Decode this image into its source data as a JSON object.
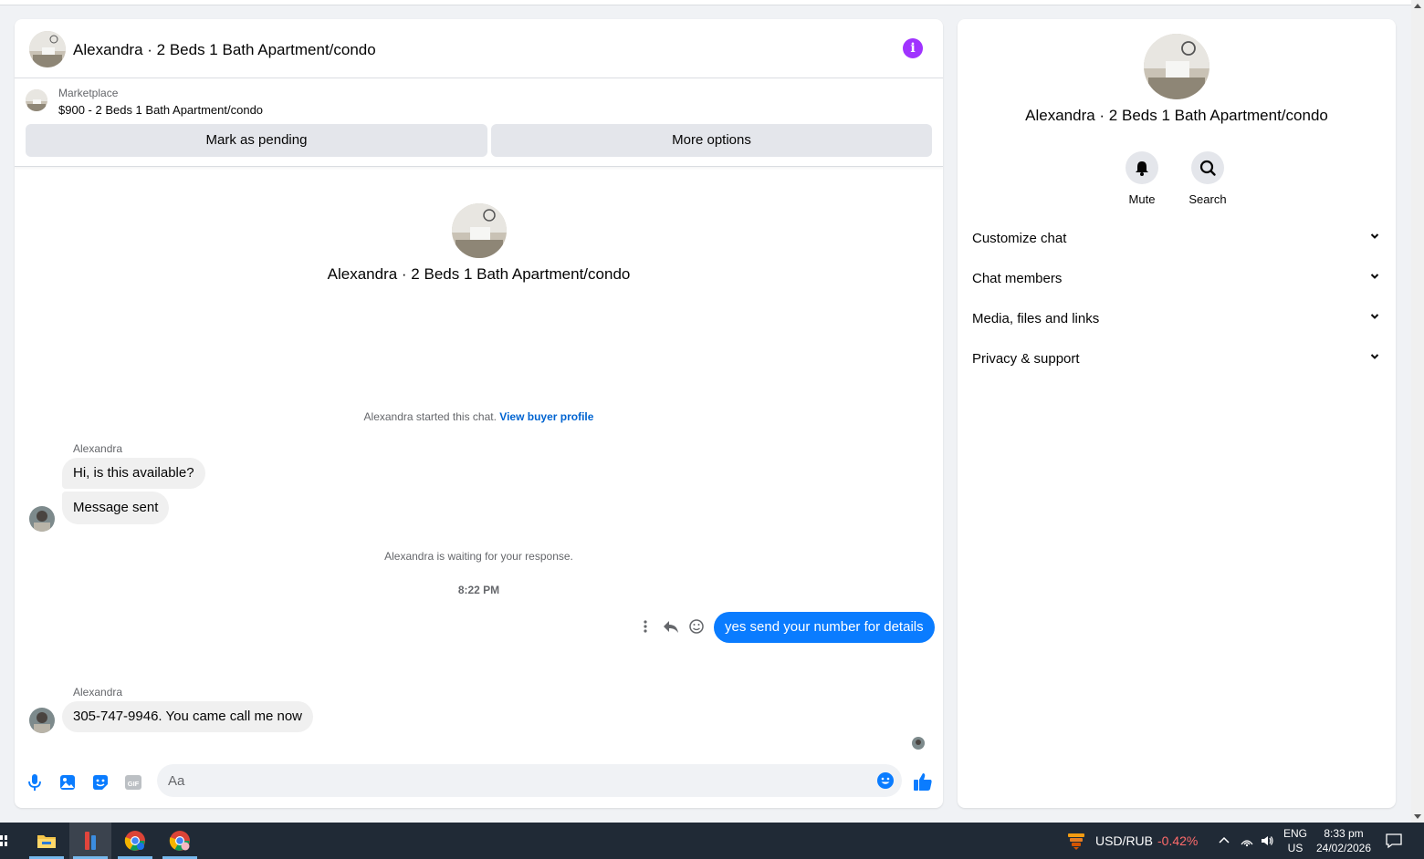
{
  "colors": {
    "accent": "#0a7cff",
    "info": "#a033ff",
    "panel": "#ffffff",
    "background": "#f0f2f5",
    "taskbar": "#202a36",
    "negative": "#ff6b6b"
  },
  "header": {
    "title": "Alexandra · 2 Beds 1 Bath Apartment/condo",
    "info_icon": "info-icon"
  },
  "listing": {
    "source": "Marketplace",
    "title": "$900 - 2 Beds 1 Bath Apartment/condo",
    "buttons": {
      "pending": "Mark as pending",
      "more": "More options"
    }
  },
  "intro": {
    "title": "Alexandra · 2 Beds 1 Bath Apartment/condo"
  },
  "chat": {
    "started_text": "Alexandra started this chat.",
    "started_link": "View buyer profile",
    "sender_name_1": "Alexandra",
    "msg1": "Hi, is this available?",
    "msg2": "Message sent",
    "waiting": "Alexandra is waiting for your response.",
    "time": "8:22 PM",
    "outgoing": "yes send your number for details",
    "sender_name_2": "Alexandra",
    "msg3": "305-747-9946.  You came call me now",
    "hover_icons": [
      "more-vertical-icon",
      "reply-icon",
      "react-emoji-icon"
    ]
  },
  "composer": {
    "placeholder": "Aa",
    "icons": [
      "microphone-icon",
      "image-icon",
      "sticker-icon",
      "gif-icon",
      "emoji-icon",
      "thumbs-up-icon"
    ],
    "gif_label": "GIF"
  },
  "info_panel": {
    "title": "Alexandra · 2 Beds 1 Bath Apartment/condo",
    "actions": [
      {
        "label": "Mute",
        "icon": "bell-icon"
      },
      {
        "label": "Search",
        "icon": "search-icon"
      }
    ],
    "sections": [
      {
        "label": "Customize chat"
      },
      {
        "label": "Chat members"
      },
      {
        "label": "Media, files and links"
      },
      {
        "label": "Privacy & support"
      }
    ]
  },
  "taskbar": {
    "apps": [
      "file-explorer-icon",
      "app-icon",
      "chrome-icon",
      "chrome-profile-icon"
    ],
    "ticker": {
      "symbol": "USD/RUB",
      "change": "-0.42%"
    },
    "lang": {
      "line1": "ENG",
      "line2": "US"
    },
    "clock": {
      "time": "8:33 pm",
      "date": "24/02/2026"
    }
  }
}
